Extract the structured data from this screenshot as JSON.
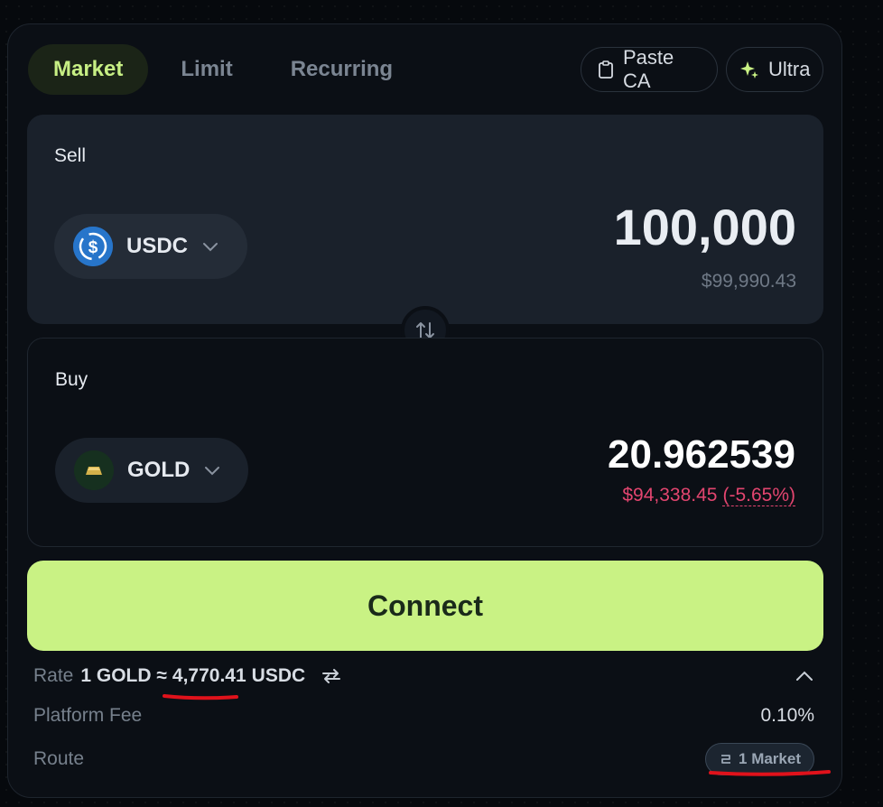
{
  "tabs": [
    {
      "label": "Market",
      "active": true
    },
    {
      "label": "Limit",
      "active": false
    },
    {
      "label": "Recurring",
      "active": false
    }
  ],
  "actions": {
    "paste_label": "Paste CA",
    "ultra_label": "Ultra"
  },
  "sell": {
    "label": "Sell",
    "token": "USDC",
    "token_icon": "usdc-icon",
    "amount": "100,000",
    "usd_value": "$99,990.43"
  },
  "buy": {
    "label": "Buy",
    "token": "GOLD",
    "token_icon": "gold-bar-icon",
    "amount": "20.962539",
    "usd_value": "$94,338.45",
    "price_impact": "(-5.65%)"
  },
  "connect_label": "Connect",
  "details": {
    "rate_label": "Rate",
    "rate_base": "1 GOLD ≈",
    "rate_value": "4,770.41",
    "rate_quote": "USDC",
    "fee_label": "Platform Fee",
    "fee_value": "0.10%",
    "route_label": "Route",
    "route_value": "1 Market"
  },
  "colors": {
    "accent": "#c9f284",
    "negative": "#e2456f",
    "annotation": "#e0121b"
  }
}
